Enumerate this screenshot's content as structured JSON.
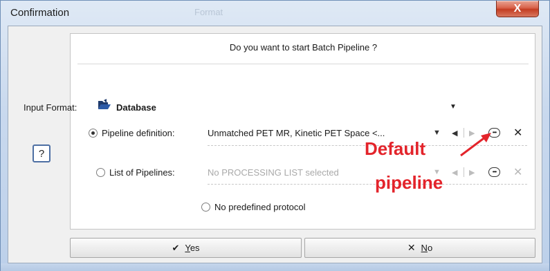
{
  "window": {
    "title": "Confirmation",
    "ghost_title": "Format",
    "close_label": "X"
  },
  "help": {
    "label": "?"
  },
  "dialog": {
    "question": "Do you want to start Batch Pipeline ?",
    "input_format": {
      "label": "Input Format:",
      "value": "Database",
      "icon": "folder-open-icon"
    },
    "options": [
      {
        "label": "Pipeline definition:",
        "selected": true,
        "value": "Unmatched PET MR, Kinetic PET Space <..."
      },
      {
        "label": "List of Pipelines:",
        "selected": false,
        "value": "No PROCESSING LIST selected"
      },
      {
        "label": "No predefined protocol",
        "selected": false
      }
    ]
  },
  "annotation": {
    "line1": "Default",
    "line2": "pipeline",
    "color": "#e3242b"
  },
  "buttons": {
    "yes": {
      "prefix": "",
      "accel": "Y",
      "rest": "es",
      "icon": "check-icon"
    },
    "no": {
      "accel": "N",
      "rest": "o",
      "icon": "x-icon"
    }
  }
}
